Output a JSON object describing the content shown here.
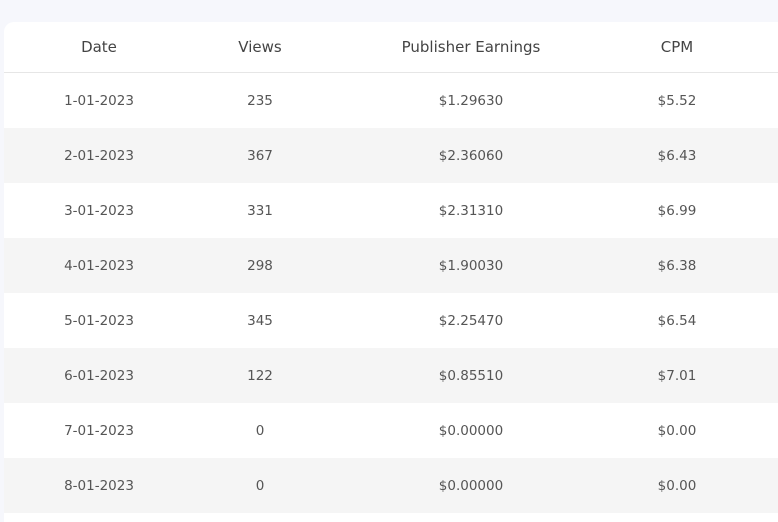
{
  "table": {
    "headers": [
      "Date",
      "Views",
      "Publisher Earnings",
      "CPM"
    ],
    "rows": [
      [
        "1-01-2023",
        "235",
        "$1.29630",
        "$5.52"
      ],
      [
        "2-01-2023",
        "367",
        "$2.36060",
        "$6.43"
      ],
      [
        "3-01-2023",
        "331",
        "$2.31310",
        "$6.99"
      ],
      [
        "4-01-2023",
        "298",
        "$1.90030",
        "$6.38"
      ],
      [
        "5-01-2023",
        "345",
        "$2.25470",
        "$6.54"
      ],
      [
        "6-01-2023",
        "122",
        "$0.85510",
        "$7.01"
      ],
      [
        "7-01-2023",
        "0",
        "$0.00000",
        "$0.00"
      ],
      [
        "8-01-2023",
        "0",
        "$0.00000",
        "$0.00"
      ]
    ]
  }
}
